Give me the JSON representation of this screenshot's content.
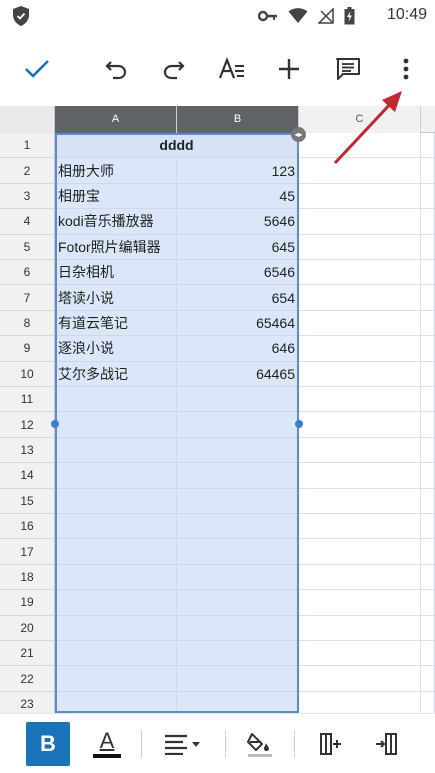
{
  "status_bar": {
    "time": "10:49",
    "icons": [
      "shield-icon",
      "key-icon",
      "wifi-icon",
      "no-signal-icon",
      "battery-charging-icon"
    ]
  },
  "toolbar": {
    "icons": [
      "check-icon",
      "undo-icon",
      "redo-icon",
      "text-format-icon",
      "add-icon",
      "comment-icon",
      "more-vert-icon"
    ]
  },
  "columns": [
    "A",
    "B",
    "C"
  ],
  "header_cell": "dddd",
  "rows": [
    {
      "num": "1"
    },
    {
      "num": "2",
      "a": "相册大师",
      "b": "123"
    },
    {
      "num": "3",
      "a": "相册宝",
      "b": "45"
    },
    {
      "num": "4",
      "a": "kodi音乐播放器",
      "b": "5646"
    },
    {
      "num": "5",
      "a": "Fotor照片编辑器",
      "b": "645"
    },
    {
      "num": "6",
      "a": "日杂相机",
      "b": "6546"
    },
    {
      "num": "7",
      "a": "塔读小说",
      "b": "654"
    },
    {
      "num": "8",
      "a": "有道云笔记",
      "b": "65464"
    },
    {
      "num": "9",
      "a": "逐浪小说",
      "b": "646"
    },
    {
      "num": "10",
      "a": "艾尔多战记",
      "b": "64465"
    },
    {
      "num": "11"
    },
    {
      "num": "12"
    },
    {
      "num": "13"
    },
    {
      "num": "14"
    },
    {
      "num": "15"
    },
    {
      "num": "16"
    },
    {
      "num": "17"
    },
    {
      "num": "18"
    },
    {
      "num": "19"
    },
    {
      "num": "20"
    },
    {
      "num": "21"
    },
    {
      "num": "22"
    },
    {
      "num": "23"
    }
  ],
  "bottom_bar": {
    "bold_label": "B",
    "text_color_label": "A",
    "icons": [
      "bold-icon",
      "text-color-icon",
      "align-icon",
      "fill-color-icon",
      "insert-column-icon",
      "insert-row-icon"
    ]
  },
  "colors": {
    "accent": "#1a73b8",
    "selection_fill": "#dbe6f8",
    "annotation_arrow": "#c0282d"
  }
}
